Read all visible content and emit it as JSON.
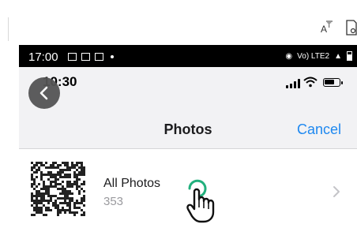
{
  "android_status": {
    "time": "17:00",
    "network": "Vo) LTE2"
  },
  "ios_status": {
    "time": "10:30",
    "battery_level": 0.7
  },
  "nav": {
    "title": "Photos",
    "cancel_label": "Cancel"
  },
  "album": {
    "title": "All Photos",
    "count": "353"
  },
  "colors": {
    "accent": "#1e88f0",
    "tap_ring": "#22b07d"
  }
}
